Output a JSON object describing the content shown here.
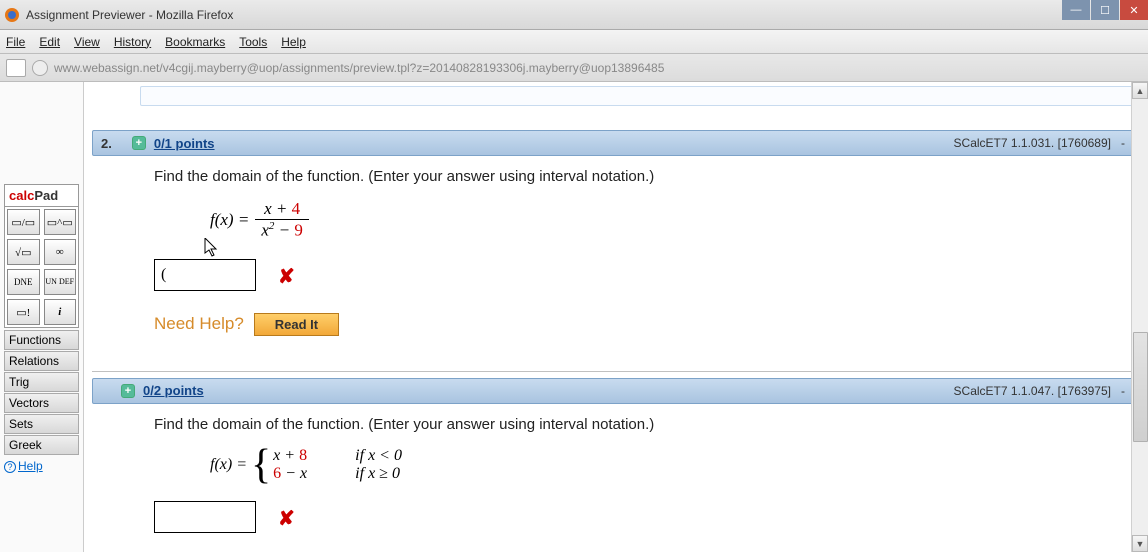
{
  "window": {
    "title": "Assignment Previewer - Mozilla Firefox"
  },
  "menubar": [
    "File",
    "Edit",
    "View",
    "History",
    "Bookmarks",
    "Tools",
    "Help"
  ],
  "url": "www.webassign.net/v4cgij.mayberry@uop/assignments/preview.tpl?z=20140828193306j.mayberry@uop13896485",
  "calcpad": {
    "title_calc": "calc",
    "title_pad": "Pad",
    "buttons_row1": [
      "▭/▭",
      "▭^▭"
    ],
    "buttons_row2": [
      "√▭",
      "∞"
    ],
    "buttons_row3": [
      "DNE",
      "UN DEF"
    ],
    "buttons_row4": [
      "▭!",
      "i"
    ],
    "categories": [
      "Functions",
      "Relations",
      "Trig",
      "Vectors",
      "Sets",
      "Greek"
    ],
    "help": "Help"
  },
  "questions": [
    {
      "number": "2.",
      "points": "0/1 points",
      "ref": "SCalcET7 1.1.031. [1760689]",
      "prompt": "Find the domain of the function. (Enter your answer using interval notation.)",
      "fx_label": "f(x)  =",
      "numerator": {
        "pre": "x + ",
        "const": "4"
      },
      "denominator": {
        "pre": "x",
        "sup": "2",
        "mid": " − ",
        "const": "9"
      },
      "answer_value": "(",
      "needhelp": "Need Help?",
      "readit": "Read It"
    },
    {
      "number": "",
      "points": "0/2 points",
      "ref": "SCalcET7 1.1.047. [1763975]",
      "prompt": "Find the domain of the function. (Enter your answer using interval notation.)",
      "fx_label": "f(x)  =",
      "case1": {
        "pre": "x + ",
        "const": "8",
        "cond": "if x < 0"
      },
      "case2": {
        "const": "6",
        "mid": " − x",
        "cond": "if x ≥ 0"
      },
      "answer_value": ""
    }
  ]
}
